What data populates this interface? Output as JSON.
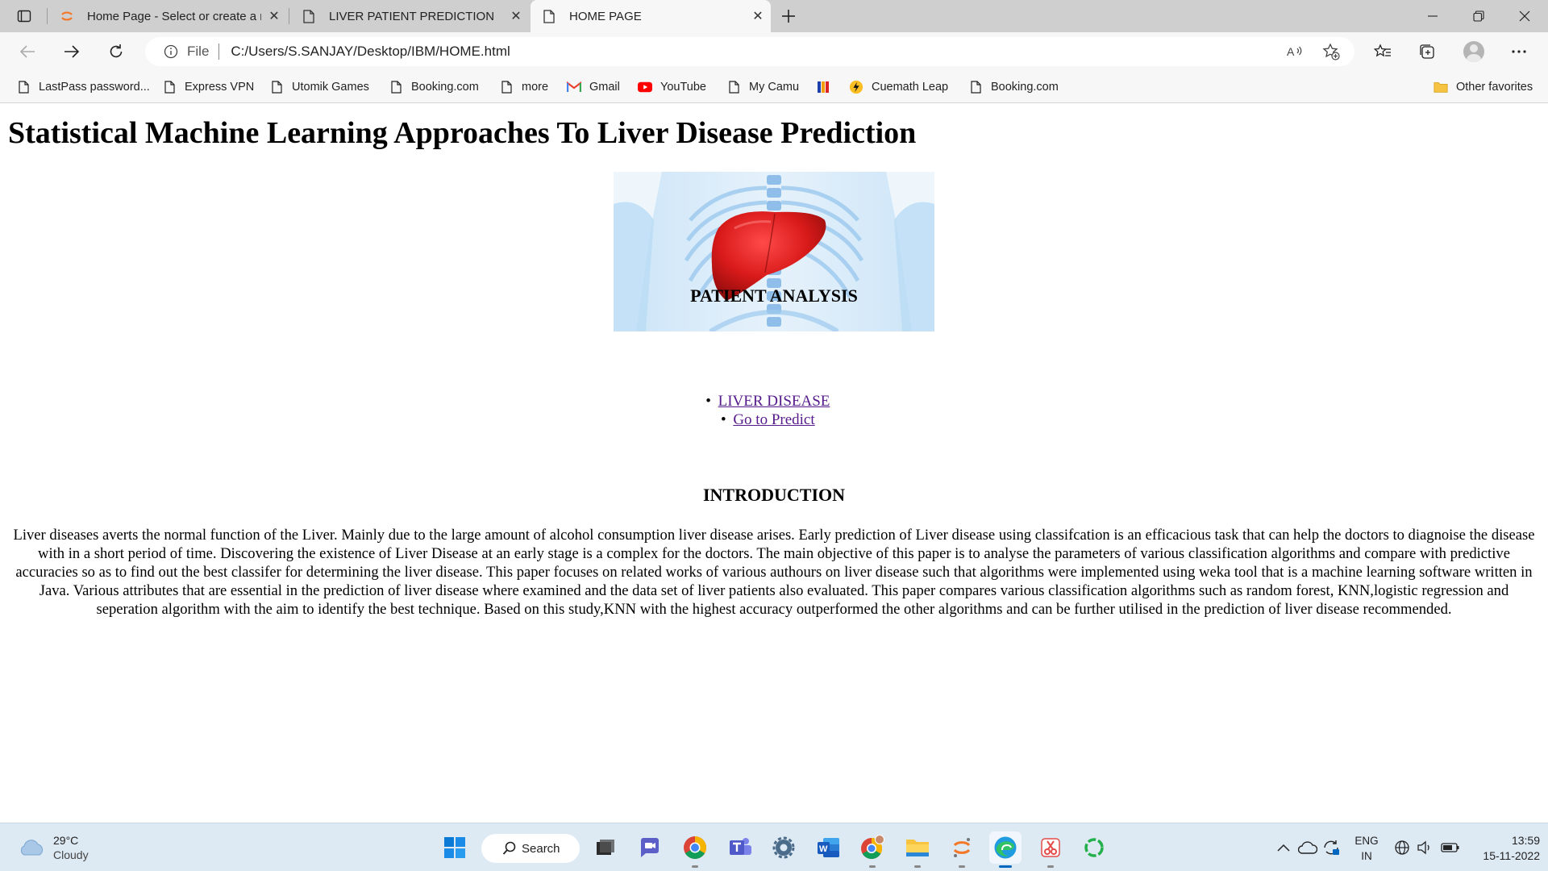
{
  "browser": {
    "tabs": [
      {
        "title": "Home Page - Select or create a n",
        "favicon": "jupyter-icon",
        "active": false
      },
      {
        "title": "LIVER PATIENT PREDICTION",
        "favicon": "page-icon",
        "active": false
      },
      {
        "title": "HOME PAGE",
        "favicon": "page-icon",
        "active": true
      }
    ],
    "address": {
      "scheme": "File",
      "url": "C:/Users/S.SANJAY/Desktop/IBM/HOME.html"
    },
    "favorites": [
      {
        "label": "LastPass password...",
        "icon": "page-icon"
      },
      {
        "label": "Express VPN",
        "icon": "page-icon"
      },
      {
        "label": "Utomik Games",
        "icon": "page-icon"
      },
      {
        "label": "Booking.com",
        "icon": "page-icon"
      },
      {
        "label": "more",
        "icon": "page-icon"
      },
      {
        "label": "Gmail",
        "icon": "gmail-icon"
      },
      {
        "label": "YouTube",
        "icon": "youtube-icon"
      },
      {
        "label": "My Camu",
        "icon": "page-icon"
      },
      {
        "label": "",
        "icon": "flag-icon"
      },
      {
        "label": "Cuemath Leap",
        "icon": "cuemath-icon"
      },
      {
        "label": "Booking.com",
        "icon": "page-icon"
      }
    ],
    "other_favorites": "Other favorites"
  },
  "page": {
    "title": "Statistical Machine Learning Approaches To Liver Disease Prediction",
    "hero_image": "liver-anatomy-image",
    "analysis_heading": "PATIENT ANALYSIS",
    "links": [
      {
        "label": "LIVER DISEASE"
      },
      {
        "label": "Go to Predict"
      }
    ],
    "intro_heading": "INTRODUCTION",
    "intro_text": "Liver diseases averts the normal function of the Liver. Mainly due to the large amount of alcohol consumption liver disease arises. Early prediction of Liver disease using classifcation is an efficacious task that can help the doctors to diagnoise the disease with in a short period of time. Discovering the existence of Liver Disease at an early stage is a complex for the doctors. The main objective of this paper is to analyse the parameters of various classification algorithms and compare with predictive accuracies so as to find out the best classifer for determining the liver disease. This paper focuses on related works of various authours on liver disease such that algorithms were implemented using weka tool that is a machine learning software written in Java. Various attributes that are essential in the prediction of liver disease where examined and the data set of liver patients also evaluated. This paper compares various classification algorithms such as random forest, KNN,logistic regression and seperation algorithm with the aim to identify the best technique. Based on this study,KNN with the highest accuracy outperformed the other algorithms and can be further utilised in the prediction of liver disease recommended."
  },
  "taskbar": {
    "weather": {
      "temp": "29°C",
      "condition": "Cloudy"
    },
    "search_label": "Search",
    "language": {
      "line1": "ENG",
      "line2": "IN"
    },
    "time": "13:59",
    "date": "15-11-2022"
  },
  "colors": {
    "link_visited": "#551a8b",
    "tabstrip": "#cfcfcf",
    "toolbar": "#f7f7f7",
    "taskbar": "#dde9f3"
  }
}
